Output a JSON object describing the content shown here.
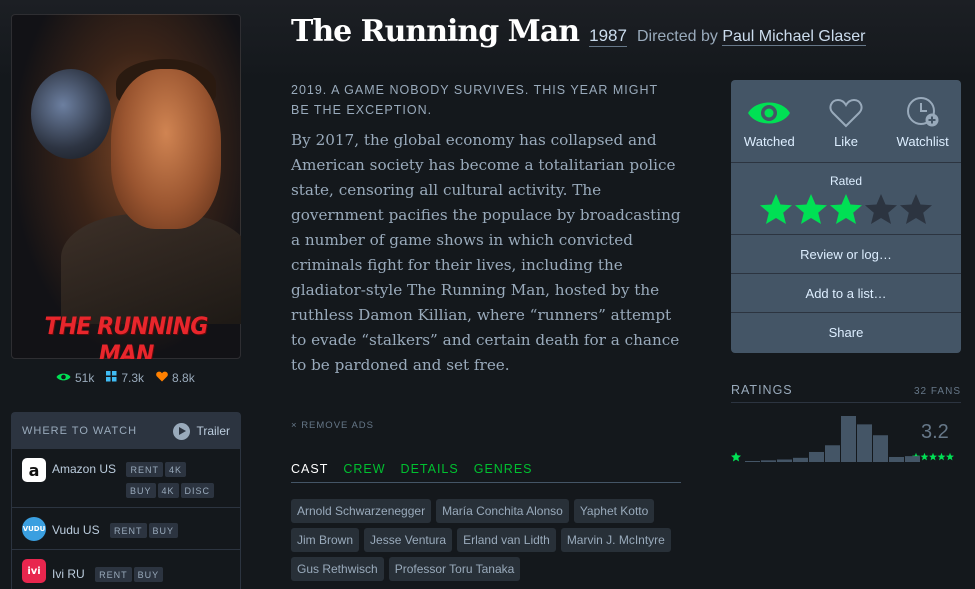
{
  "poster": {
    "title": "THE RUNNING MAN"
  },
  "stats": {
    "watched": "51k",
    "lists": "7.3k",
    "likes": "8.8k"
  },
  "where_to_watch": {
    "label": "WHERE TO WATCH",
    "trailer": "Trailer",
    "services": [
      {
        "name": "Amazon US",
        "logo_text": "a",
        "tags_row1": [
          "RENT",
          "4K"
        ],
        "tags_row2": [
          "BUY",
          "4K",
          "DISC"
        ]
      },
      {
        "name": "Vudu US",
        "logo_text": "VUDU",
        "tags": [
          "RENT",
          "BUY"
        ]
      },
      {
        "name": "Ivi RU",
        "logo_text": "ivi",
        "tags": [
          "RENT",
          "BUY"
        ]
      }
    ]
  },
  "film": {
    "title": "The Running Man",
    "year": "1987",
    "directed_by": "Directed by",
    "director": "Paul Michael Glaser",
    "tagline": "2019. A game nobody survives. This year might be the exception.",
    "synopsis": "By 2017, the global economy has collapsed and American society has become a totalitarian police state, censoring all cultural activity. The government pacifies the populace by broadcasting a number of game shows in which convicted criminals fight for their lives, including the gladiator-style The Running Man, hosted by the ruthless Damon Killian, where “runners” attempt to evade “stalkers” and certain death for a chance to be pardoned and set free."
  },
  "remove_ads": "REMOVE ADS",
  "tabs": [
    "CAST",
    "CREW",
    "DETAILS",
    "GENRES"
  ],
  "cast": [
    "Arnold Schwarzenegger",
    "María Conchita Alonso",
    "Yaphet Kotto",
    "Jim Brown",
    "Jesse Ventura",
    "Erland van Lidth",
    "Marvin J. McIntyre",
    "Gus Rethwisch",
    "Professor Toru Tanaka"
  ],
  "actions": {
    "watched": "Watched",
    "like": "Like",
    "watchlist": "Watchlist",
    "rated": "Rated",
    "rating_stars": 3,
    "review": "Review or log…",
    "add_list": "Add to a list…",
    "share": "Share"
  },
  "ratings": {
    "title": "RATINGS",
    "fans": "32 FANS",
    "average": "3.2",
    "histogram": [
      1,
      2,
      3,
      5,
      12,
      20,
      55,
      45,
      32,
      6,
      7
    ]
  },
  "colors": {
    "accent_green": "#00e054",
    "orange": "#ff8000",
    "blue": "#40bcf4",
    "panel": "#445566",
    "bg": "#14181c"
  }
}
